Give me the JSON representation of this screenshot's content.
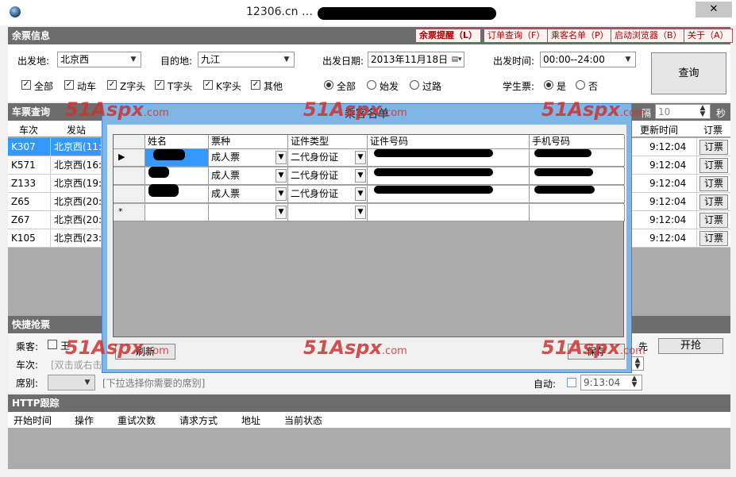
{
  "window": {
    "title": "12306.cn",
    "title_suffix": "…",
    "close": "✕"
  },
  "sections": {
    "ticket_info": "余票信息",
    "ticket_query": "车票查询",
    "quick_grab": "快捷抢票",
    "http_trace": "HTTP跟踪"
  },
  "header_buttons": [
    "余票提醒（L）",
    "订单查询（F）",
    "乘客名单（P）",
    "启动浏览器（B）",
    "关于（A）"
  ],
  "search": {
    "from_label": "出发地:",
    "from_value": "北京西",
    "to_label": "目的地:",
    "to_value": "九江",
    "date_label": "出发日期:",
    "date_value": "2013年11月18日",
    "time_label": "出发时间:",
    "time_value": "00:00--24:00",
    "query_button": "查询",
    "train_types": [
      "全部",
      "动车",
      "Z字头",
      "T字头",
      "K字头",
      "其他"
    ],
    "station_filters": [
      "全部",
      "始发",
      "过路"
    ],
    "student_label": "学生票:",
    "student_yes": "是",
    "student_no": "否",
    "interval_label": "隔",
    "interval_value": "10",
    "interval_unit": "秒"
  },
  "grid": {
    "headers": [
      "车次",
      "发站",
      "更新时间",
      "订票"
    ],
    "rows": [
      {
        "train": "K307",
        "from": "北京西(11:",
        "updated": "9:12:04",
        "book": "订票"
      },
      {
        "train": "K571",
        "from": "北京西(16:",
        "updated": "9:12:04",
        "book": "订票"
      },
      {
        "train": "Z133",
        "from": "北京西(19:",
        "updated": "9:12:04",
        "book": "订票"
      },
      {
        "train": "Z65",
        "from": "北京西(20:",
        "updated": "9:12:04",
        "book": "订票"
      },
      {
        "train": "Z67",
        "from": "北京西(20:",
        "updated": "9:12:04",
        "book": "订票"
      },
      {
        "train": "K105",
        "from": "北京西(23:",
        "updated": "9:12:04",
        "book": "订票"
      }
    ]
  },
  "quick": {
    "passenger_label": "乘客:",
    "passenger_first": "王",
    "train_label": "车次:",
    "train_placeholder": "[双击或右击",
    "seat_label": "席别:",
    "seat_hint": "[下拉选择你需要的席别]",
    "auto_label": "自动:",
    "auto_time": "9:13:04",
    "first_label": "先",
    "start_button": "开抢"
  },
  "http": {
    "headers": [
      "开始时间",
      "操作",
      "重试次数",
      "请求方式",
      "地址",
      "当前状态"
    ]
  },
  "dialog": {
    "title": "乘客名单",
    "headers": [
      "姓名",
      "票种",
      "证件类型",
      "证件号码",
      "手机号码"
    ],
    "rows": [
      {
        "ticket": "成人票",
        "id_type": "二代身份证"
      },
      {
        "ticket": "成人票",
        "id_type": "二代身份证"
      },
      {
        "ticket": "成人票",
        "id_type": "二代身份证"
      }
    ],
    "new_row_marker": "*",
    "current_row_marker": "▶",
    "refresh_button": "刷新",
    "save_button": "保存"
  },
  "watermark": {
    "brand": "51Aspx",
    "domain": ".com"
  }
}
